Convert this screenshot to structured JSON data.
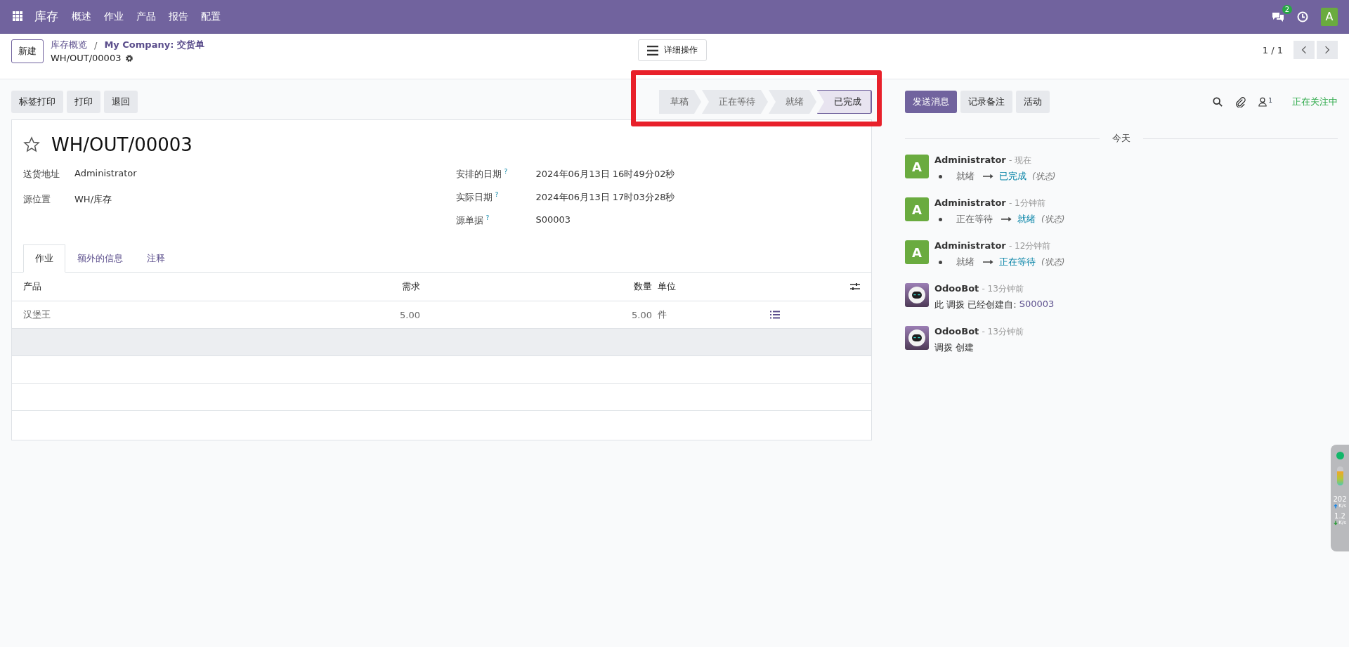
{
  "navbar": {
    "app_name": "库存",
    "menu": [
      "概述",
      "作业",
      "产品",
      "报告",
      "配置"
    ],
    "messages_badge": "2",
    "avatar": "A"
  },
  "control_panel": {
    "new_button": "新建",
    "breadcrumbs": [
      "库存概览",
      "My Company: 交货单"
    ],
    "breadcrumb_separator": "/",
    "record_name": "WH/OUT/00003",
    "action_button": "详细操作",
    "pager": "1 / 1"
  },
  "buttons": [
    "标签打印",
    "打印",
    "退回"
  ],
  "statusbar": [
    {
      "label": "草稿",
      "selected": false
    },
    {
      "label": "正在等待",
      "selected": false
    },
    {
      "label": "就绪",
      "selected": false
    },
    {
      "label": "已完成",
      "selected": true
    }
  ],
  "chatter_buttons": [
    {
      "label": "发送消息",
      "kind": "primary"
    },
    {
      "label": "记录备注",
      "kind": "secondary"
    },
    {
      "label": "活动",
      "kind": "secondary"
    }
  ],
  "followers_count": "1",
  "follow_status": "正在关注中",
  "form": {
    "title": "WH/OUT/00003",
    "favorite": false,
    "fields_left": [
      {
        "label": "送货地址",
        "value": "Administrator"
      },
      {
        "label": "源位置",
        "value": "WH/库存"
      }
    ],
    "fields_right": [
      {
        "label": "安排的日期",
        "help": "?",
        "value": "2024年06月13日 16时49分02秒"
      },
      {
        "label": "实际日期",
        "help": "?",
        "value": "2024年06月13日 17时03分28秒"
      },
      {
        "label": "源单据",
        "help": "?",
        "value": "S00003"
      }
    ],
    "tabs": [
      {
        "label": "作业",
        "selected": true
      },
      {
        "label": "额外的信息",
        "selected": false
      },
      {
        "label": "注释",
        "selected": false
      }
    ],
    "table": {
      "columns": [
        "产品",
        "需求",
        "数量",
        "单位"
      ],
      "rows": [
        {
          "product": "汉堡王",
          "demand": "5.00",
          "quantity": "5.00",
          "unit": "件"
        }
      ]
    }
  },
  "chatter": {
    "date_label": "今天",
    "messages": [
      {
        "kind": "tracking",
        "avatar_text": "A",
        "author": "Administrator",
        "time": "- 现在",
        "old": "就绪",
        "new": "已完成",
        "field": "(状态)"
      },
      {
        "kind": "tracking",
        "avatar_text": "A",
        "author": "Administrator",
        "time": "- 1分钟前",
        "old": "正在等待",
        "new": "就绪",
        "field": "(状态)"
      },
      {
        "kind": "tracking",
        "avatar_text": "A",
        "author": "Administrator",
        "time": "- 12分钟前",
        "old": "就绪",
        "new": "正在等待",
        "field": "(状态)"
      },
      {
        "kind": "note",
        "author": "OdooBot",
        "time": "- 13分钟前",
        "body": "此 调拨 已经创建自:",
        "link": "S00003"
      },
      {
        "kind": "note",
        "author": "OdooBot",
        "time": "- 13分钟前",
        "body": "调拨 创建"
      }
    ]
  },
  "net_widget": {
    "upload": "202",
    "upload_unit": "K/s",
    "download": "1.2",
    "download_unit": "K/s"
  }
}
